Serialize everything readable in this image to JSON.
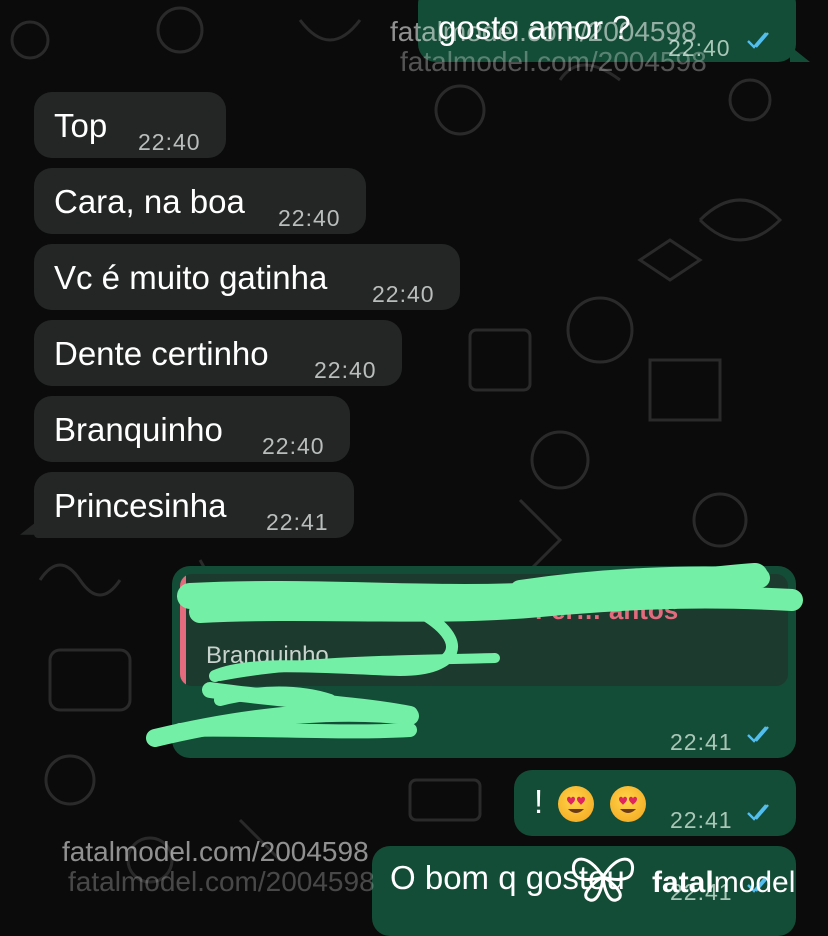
{
  "chat": {
    "messages": [
      {
        "side": "out",
        "text": "gosto amor ?",
        "time": "22:40",
        "read": true
      },
      {
        "side": "in",
        "text": "Top",
        "time": "22:40"
      },
      {
        "side": "in",
        "text": "Cara, na boa",
        "time": "22:40"
      },
      {
        "side": "in",
        "text": "Vc é muito gatinha",
        "time": "22:40"
      },
      {
        "side": "in",
        "text": "Dente certinho",
        "time": "22:40"
      },
      {
        "side": "in",
        "text": "Branquinho",
        "time": "22:40"
      },
      {
        "side": "in",
        "text": "Princesinha",
        "time": "22:41"
      },
      {
        "side": "out",
        "reply_name": "~Fer… antos",
        "reply_text": "Branquinho",
        "time": "22:41",
        "read": true
      },
      {
        "side": "out",
        "text": "!",
        "emojis": [
          "smiling-heart-eyes",
          "smiling-heart-eyes"
        ],
        "time": "22:41",
        "read": true
      },
      {
        "side": "out",
        "text": "O bom q gostou",
        "time": "22:41",
        "read": true
      }
    ]
  },
  "watermark": {
    "site_text": "fatalmodel.com/2004598",
    "brand_prefix": "fatal",
    "brand_suffix": "model"
  },
  "colors": {
    "background": "#0b0b0b",
    "incoming_bubble": "#242626",
    "outgoing_bubble": "#144d37",
    "read_ticks": "#53bdeb",
    "reply_accent": "#e46b7d",
    "redaction": "#74f0a6"
  },
  "icons": {
    "read_receipt": "double-check-icon",
    "emoji": "smiling-face-with-heart-eyes-icon",
    "brand_logo": "butterfly-icon"
  }
}
